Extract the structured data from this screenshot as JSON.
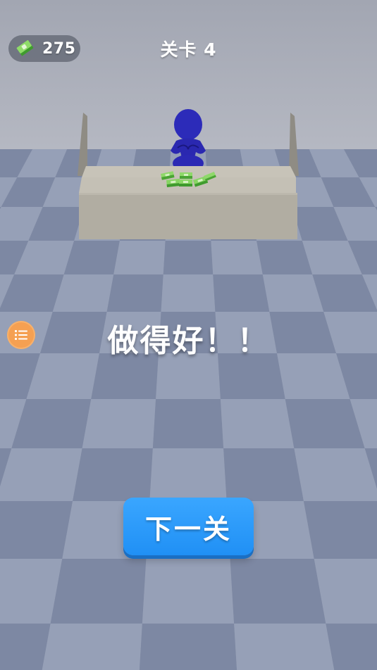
{
  "hud": {
    "cash_icon": "cash-stack-icon",
    "cash_value": "275",
    "level_label": "关卡 4"
  },
  "scene": {
    "character": "blue-stickman",
    "prop": "money-stacks-on-counter"
  },
  "menu": {
    "icon": "list-icon"
  },
  "result": {
    "praise_text": "做得好！！"
  },
  "actions": {
    "next_label": "下一关"
  },
  "colors": {
    "accent_button": "#2f9cff",
    "menu_button": "#f5a052",
    "character": "#2b2bb8",
    "cash": "#5cc443"
  }
}
